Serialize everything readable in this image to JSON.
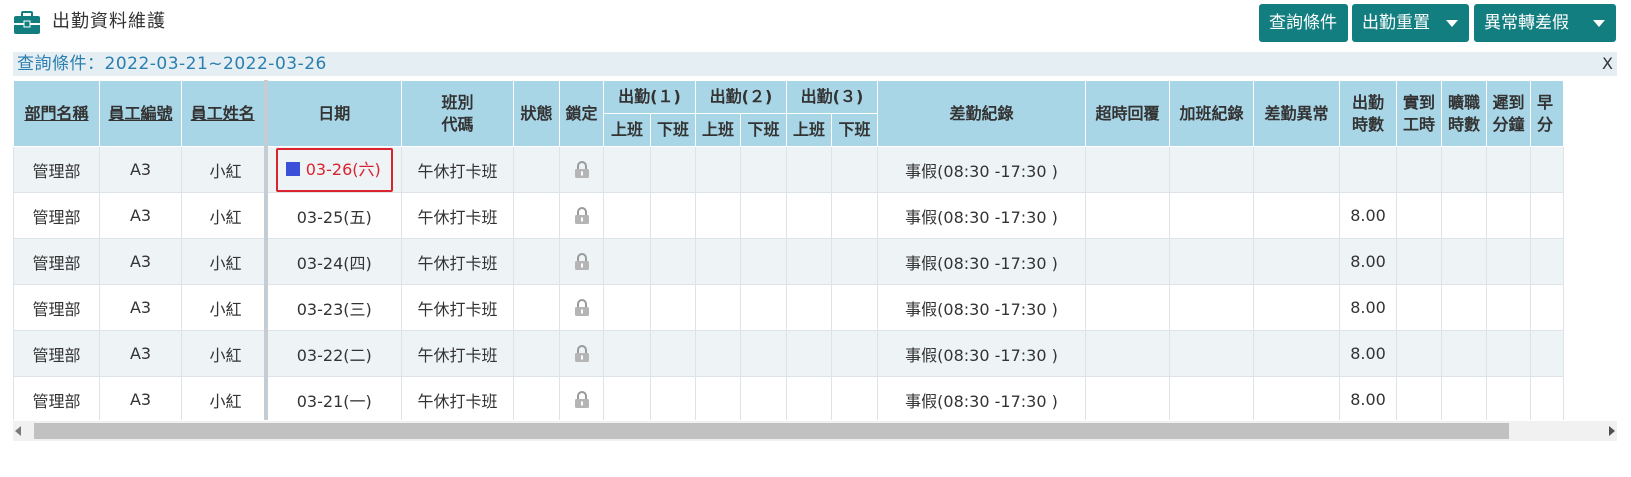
{
  "header": {
    "title": "出勤資料維護",
    "icon": "briefcase-icon",
    "buttons": {
      "query": "查詢條件",
      "reset": "出勤重置",
      "abnormal": "異常轉差假"
    }
  },
  "condition": {
    "text": "查詢條件：2022-03-21~2022-03-26",
    "close": "X"
  },
  "columns": {
    "dept": "部門名稱",
    "emp_no": "員工編號",
    "emp_name": "員工姓名",
    "date": "日期",
    "shift_l1": "班別",
    "shift_l2": "代碼",
    "status": "狀態",
    "lock": "鎖定",
    "att1": "出勤(１)",
    "att2": "出勤(２)",
    "att3": "出勤(３)",
    "clock_in": "上班",
    "clock_out": "下班",
    "leave": "差勤紀錄",
    "overtime_reply": "超時回覆",
    "overtime_record": "加班紀錄",
    "leave_abnormal": "差勤異常",
    "hours_l1": "出勤",
    "hours_l2": "時數",
    "actual_l1": "實到",
    "actual_l2": "工時",
    "absent_l1": "曠職",
    "absent_l2": "時數",
    "late_l1": "遲到",
    "late_l2": "分鐘",
    "early_l1": "早",
    "early_l2": "分"
  },
  "rows": [
    {
      "dept": "管理部",
      "emp_no": "A3",
      "emp_name": "小紅",
      "date": "03-26(六)",
      "shift": "午休打卡班",
      "leave": "事假(08:30 -17:30 )",
      "hours": "",
      "highlighted": true
    },
    {
      "dept": "管理部",
      "emp_no": "A3",
      "emp_name": "小紅",
      "date": "03-25(五)",
      "shift": "午休打卡班",
      "leave": "事假(08:30 -17:30 )",
      "hours": "8.00"
    },
    {
      "dept": "管理部",
      "emp_no": "A3",
      "emp_name": "小紅",
      "date": "03-24(四)",
      "shift": "午休打卡班",
      "leave": "事假(08:30 -17:30 )",
      "hours": "8.00"
    },
    {
      "dept": "管理部",
      "emp_no": "A3",
      "emp_name": "小紅",
      "date": "03-23(三)",
      "shift": "午休打卡班",
      "leave": "事假(08:30 -17:30 )",
      "hours": "8.00"
    },
    {
      "dept": "管理部",
      "emp_no": "A3",
      "emp_name": "小紅",
      "date": "03-22(二)",
      "shift": "午休打卡班",
      "leave": "事假(08:30 -17:30 )",
      "hours": "8.00"
    },
    {
      "dept": "管理部",
      "emp_no": "A3",
      "emp_name": "小紅",
      "date": "03-21(一)",
      "shift": "午休打卡班",
      "leave": "事假(08:30 -17:30 )",
      "hours": "8.00"
    }
  ],
  "colors": {
    "accent": "#137e80",
    "header_bg": "#a9d6e7",
    "highlight_border": "#d9232e",
    "marker": "#3b4fd8"
  }
}
